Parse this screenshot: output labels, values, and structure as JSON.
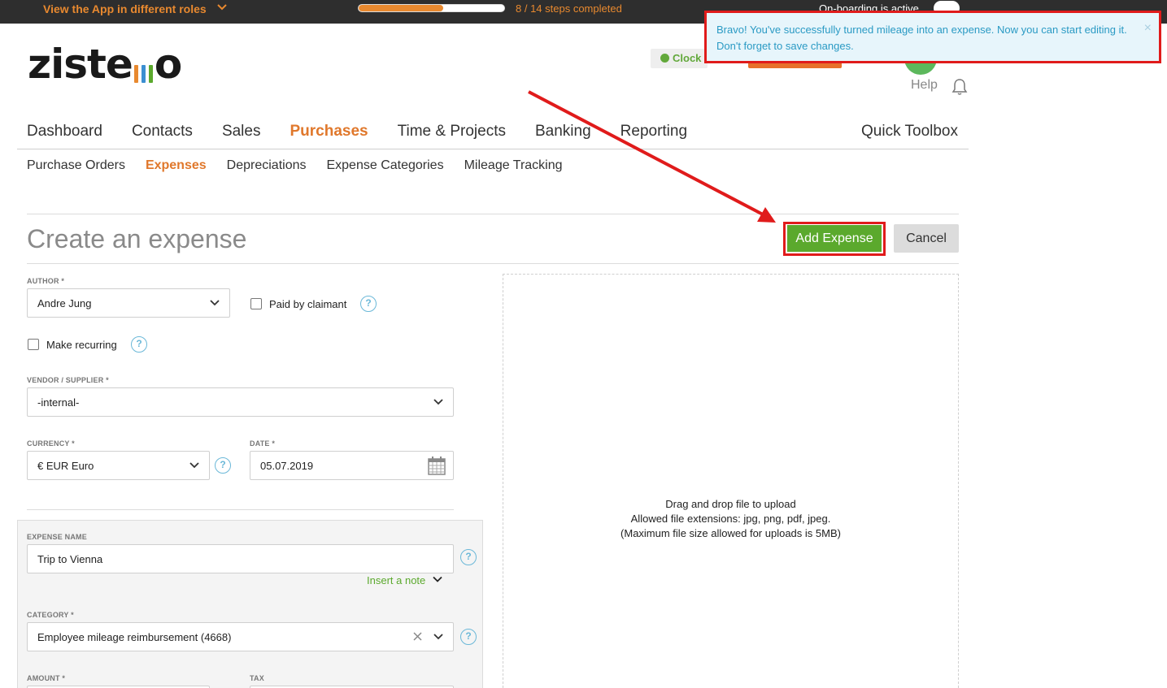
{
  "topbar": {
    "roles_label": "View the App in different roles",
    "progress_fraction": 0.58,
    "steps_label": "8 / 14 steps completed",
    "onboarding_label": "On-boarding is active"
  },
  "brand": {
    "logo_text_start": "ziste",
    "logo_text_end": "o",
    "bar_colors": [
      "#e8892f",
      "#3b8fd1",
      "#5ba92d"
    ]
  },
  "header": {
    "clock_label": "Clock",
    "help_label": "Help"
  },
  "toast": {
    "message": "Bravo! You've successfully turned mileage into an expense. Now you can start editing it. Don't forget to save changes.",
    "close": "×"
  },
  "mainnav": {
    "items": [
      "Dashboard",
      "Contacts",
      "Sales",
      "Purchases",
      "Time & Projects",
      "Banking",
      "Reporting"
    ],
    "active": "Purchases",
    "quick_toolbox": "Quick Toolbox"
  },
  "subnav": {
    "items": [
      "Purchase Orders",
      "Expenses",
      "Depreciations",
      "Expense Categories",
      "Mileage Tracking"
    ],
    "active": "Expenses"
  },
  "page": {
    "title": "Create an expense",
    "add_button": "Add Expense",
    "cancel_button": "Cancel"
  },
  "form": {
    "author_label": "AUTHOR *",
    "author_value": "Andre Jung",
    "paid_by_claimant": "Paid by claimant",
    "make_recurring": "Make recurring",
    "vendor_label": "VENDOR / SUPPLIER *",
    "vendor_value": "-internal-",
    "currency_label": "CURRENCY *",
    "currency_value": "€ EUR Euro",
    "date_label": "DATE *",
    "date_value": "05.07.2019",
    "expense_name_label": "EXPENSE NAME",
    "expense_name_value": "Trip to Vienna",
    "insert_note": "Insert a note",
    "category_label": "CATEGORY *",
    "category_value": "Employee mileage reimbursement (4668)",
    "amount_label": "AMOUNT *",
    "tax_label": "TAX",
    "help_glyph": "?"
  },
  "dropzone": {
    "line1": "Drag and drop file to upload",
    "line2": "Allowed file extensions: jpg, png, pdf, jpeg.",
    "line3": "(Maximum file size allowed for uploads is 5MB)"
  },
  "colors": {
    "accent_orange": "#e0782c",
    "primary_green": "#5ba92d",
    "annotation_red": "#e01b1b",
    "info_blue": "#2a9ac4"
  }
}
